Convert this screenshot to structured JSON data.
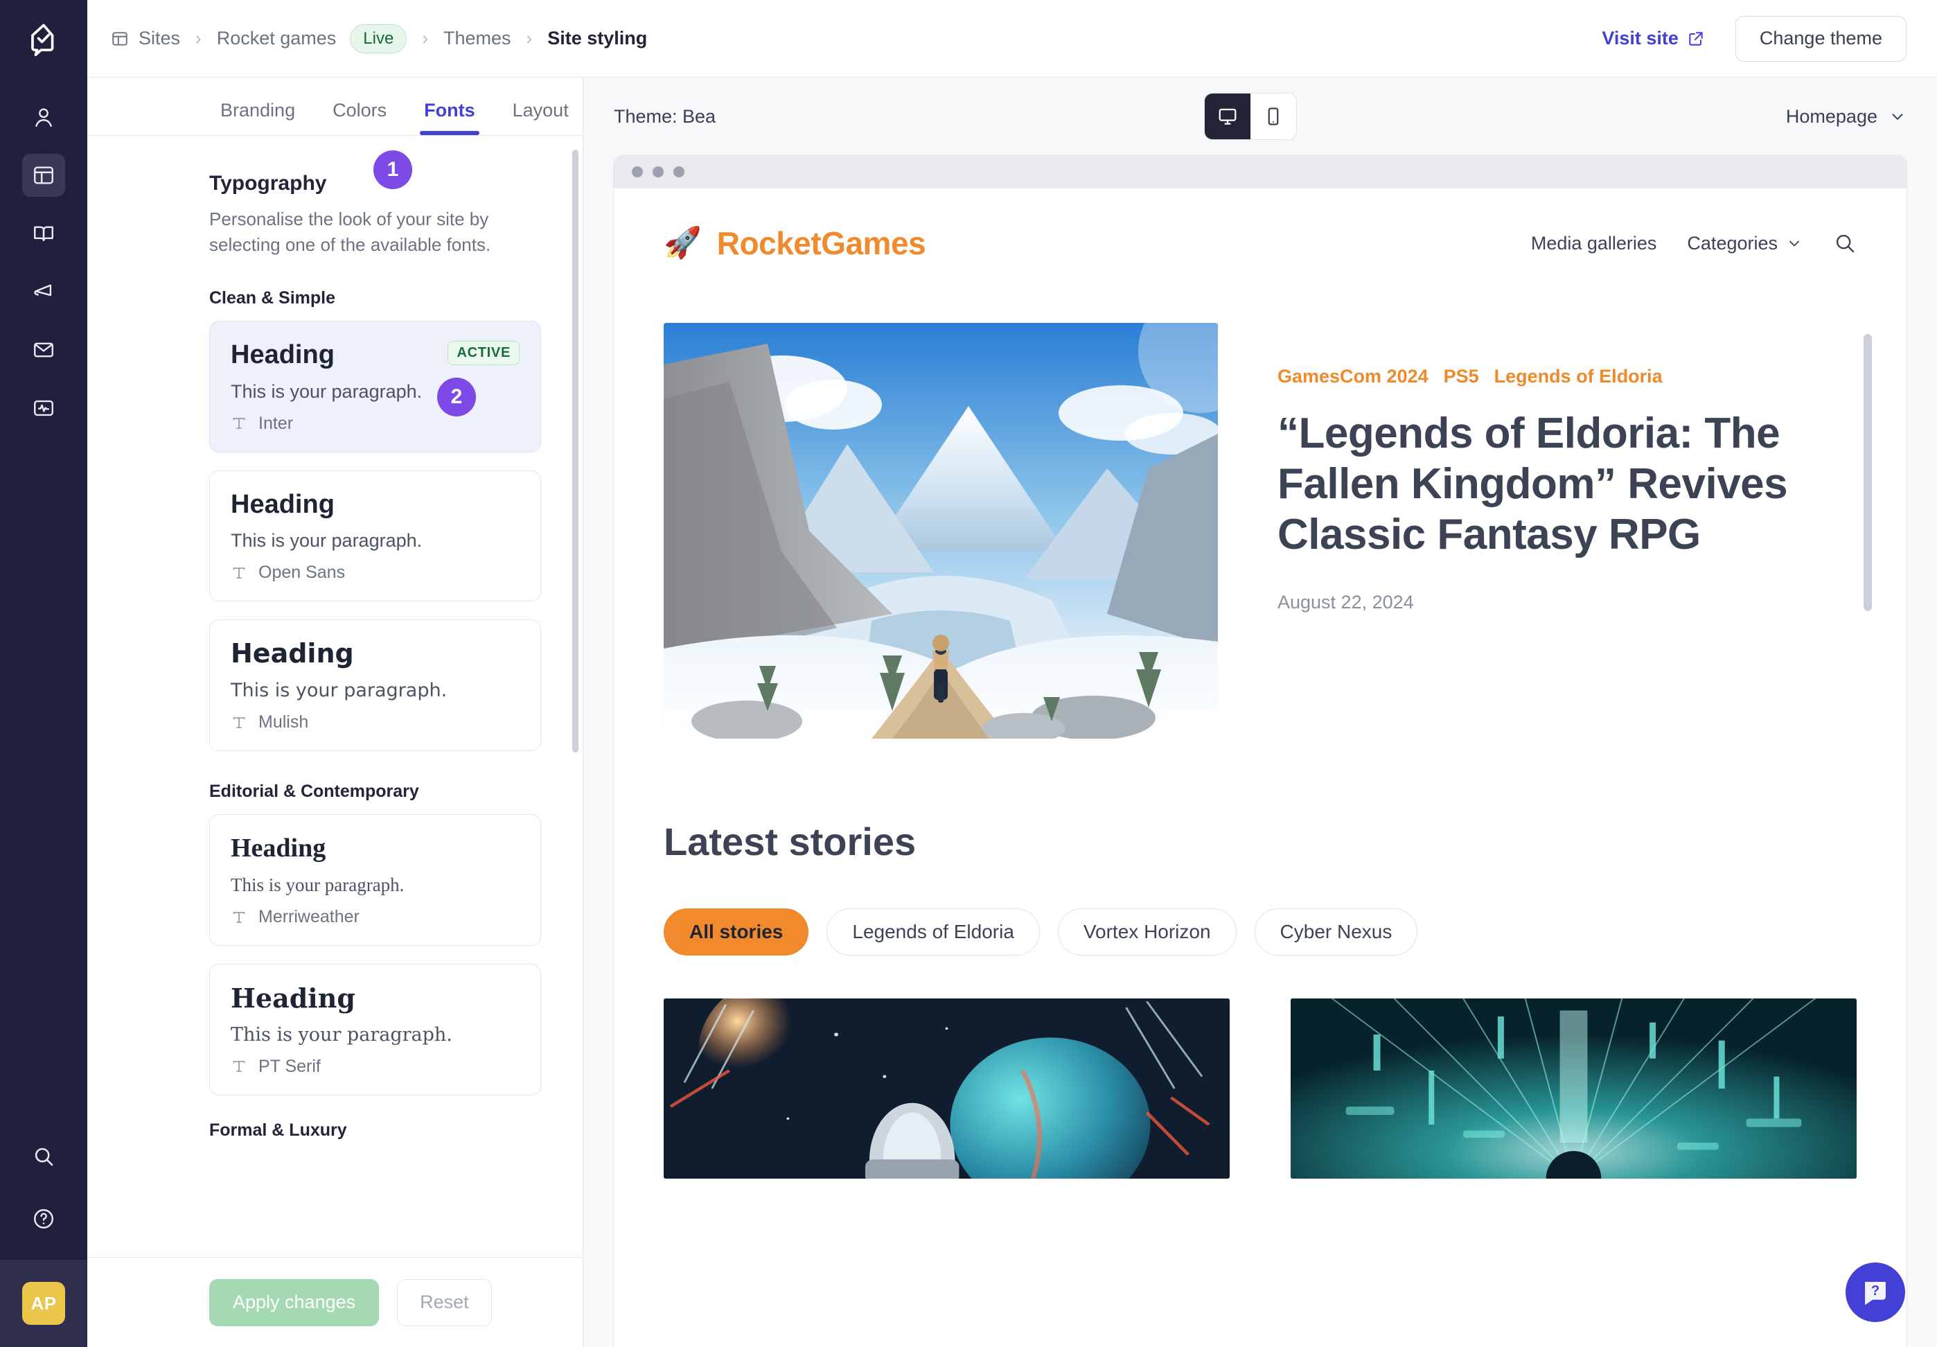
{
  "rail": {
    "logo_icon": "app-logo-icon",
    "items": [
      {
        "icon": "user-icon",
        "name": "rail-item-people",
        "active": false
      },
      {
        "icon": "layout-icon",
        "name": "rail-item-sites",
        "active": true
      },
      {
        "icon": "book-icon",
        "name": "rail-item-content",
        "active": false
      },
      {
        "icon": "megaphone-icon",
        "name": "rail-item-campaigns",
        "active": false
      },
      {
        "icon": "mail-icon",
        "name": "rail-item-email",
        "active": false
      },
      {
        "icon": "analytics-icon",
        "name": "rail-item-analytics",
        "active": false
      }
    ],
    "bottom": [
      {
        "icon": "search-icon",
        "name": "rail-item-search"
      },
      {
        "icon": "help-circle-icon",
        "name": "rail-item-help"
      }
    ],
    "avatar_initials": "AP",
    "avatar_color": "#e9c649"
  },
  "topbar": {
    "breadcrumbs": [
      {
        "label": "Sites",
        "icon": "sites-icon"
      },
      {
        "label": "Rocket games",
        "badge": "Live"
      },
      {
        "label": "Themes"
      },
      {
        "label": "Site styling",
        "current": true
      }
    ],
    "visit_site_label": "Visit site",
    "change_theme_label": "Change theme"
  },
  "panel": {
    "tabs": [
      {
        "label": "Branding",
        "active": false
      },
      {
        "label": "Colors",
        "active": false
      },
      {
        "label": "Fonts",
        "active": true
      },
      {
        "label": "Layout",
        "active": false
      }
    ],
    "title": "Typography",
    "description": "Personalise the look of your site by selecting one of the available fonts.",
    "active_badge_label": "ACTIVE",
    "sample_heading": "Heading",
    "sample_paragraph": "This is your paragraph.",
    "groups": [
      {
        "label": "Clean & Simple",
        "fonts": [
          {
            "name": "Inter",
            "selected": true,
            "active": true,
            "style": "sans"
          },
          {
            "name": "Open Sans",
            "selected": false,
            "active": false,
            "style": "sans"
          },
          {
            "name": "Mulish",
            "selected": false,
            "active": false,
            "style": "dsans"
          }
        ]
      },
      {
        "label": "Editorial & Contemporary",
        "fonts": [
          {
            "name": "Merriweather",
            "selected": false,
            "active": false,
            "style": "serif"
          },
          {
            "name": "PT Serif",
            "selected": false,
            "active": false,
            "style": "dserif"
          }
        ]
      },
      {
        "label": "Formal & Luxury",
        "fonts": []
      }
    ],
    "apply_label": "Apply changes",
    "reset_label": "Reset"
  },
  "markers": [
    {
      "number": "1",
      "target": "colors-tab"
    },
    {
      "number": "2",
      "target": "clean-simple-group"
    }
  ],
  "preview": {
    "theme_label": "Theme: Bea",
    "device_desktop_icon": "monitor-icon",
    "device_mobile_icon": "mobile-icon",
    "active_device": "desktop",
    "page_selector": "Homepage",
    "site": {
      "brand_name": "RocketGames",
      "brand_icon": "rocket-icon",
      "brand_color": "#f08a2c",
      "nav": [
        {
          "label": "Media galleries",
          "has_chevron": false
        },
        {
          "label": "Categories",
          "has_chevron": true
        }
      ],
      "search_icon": "search-icon",
      "hero": {
        "tags": [
          "GamesCom 2024",
          "PS5",
          "Legends of Eldoria"
        ],
        "title": "“Legends of Eldoria: The Fallen Kingdom” Revives Classic Fantasy RPG",
        "date": "August 22, 2024",
        "image_alt": "snowy-mountain-valley-with-lone-traveler"
      },
      "latest_title": "Latest stories",
      "chips": [
        {
          "label": "All stories",
          "active": true
        },
        {
          "label": "Legends of Eldoria",
          "active": false
        },
        {
          "label": "Vortex Horizon",
          "active": false
        },
        {
          "label": "Cyber Nexus",
          "active": false
        }
      ],
      "cards": [
        {
          "image_alt": "spaceship-approaching-planet"
        },
        {
          "image_alt": "neon-cyber-corridor"
        }
      ]
    },
    "help_fab_icon": "question-mark-icon"
  }
}
